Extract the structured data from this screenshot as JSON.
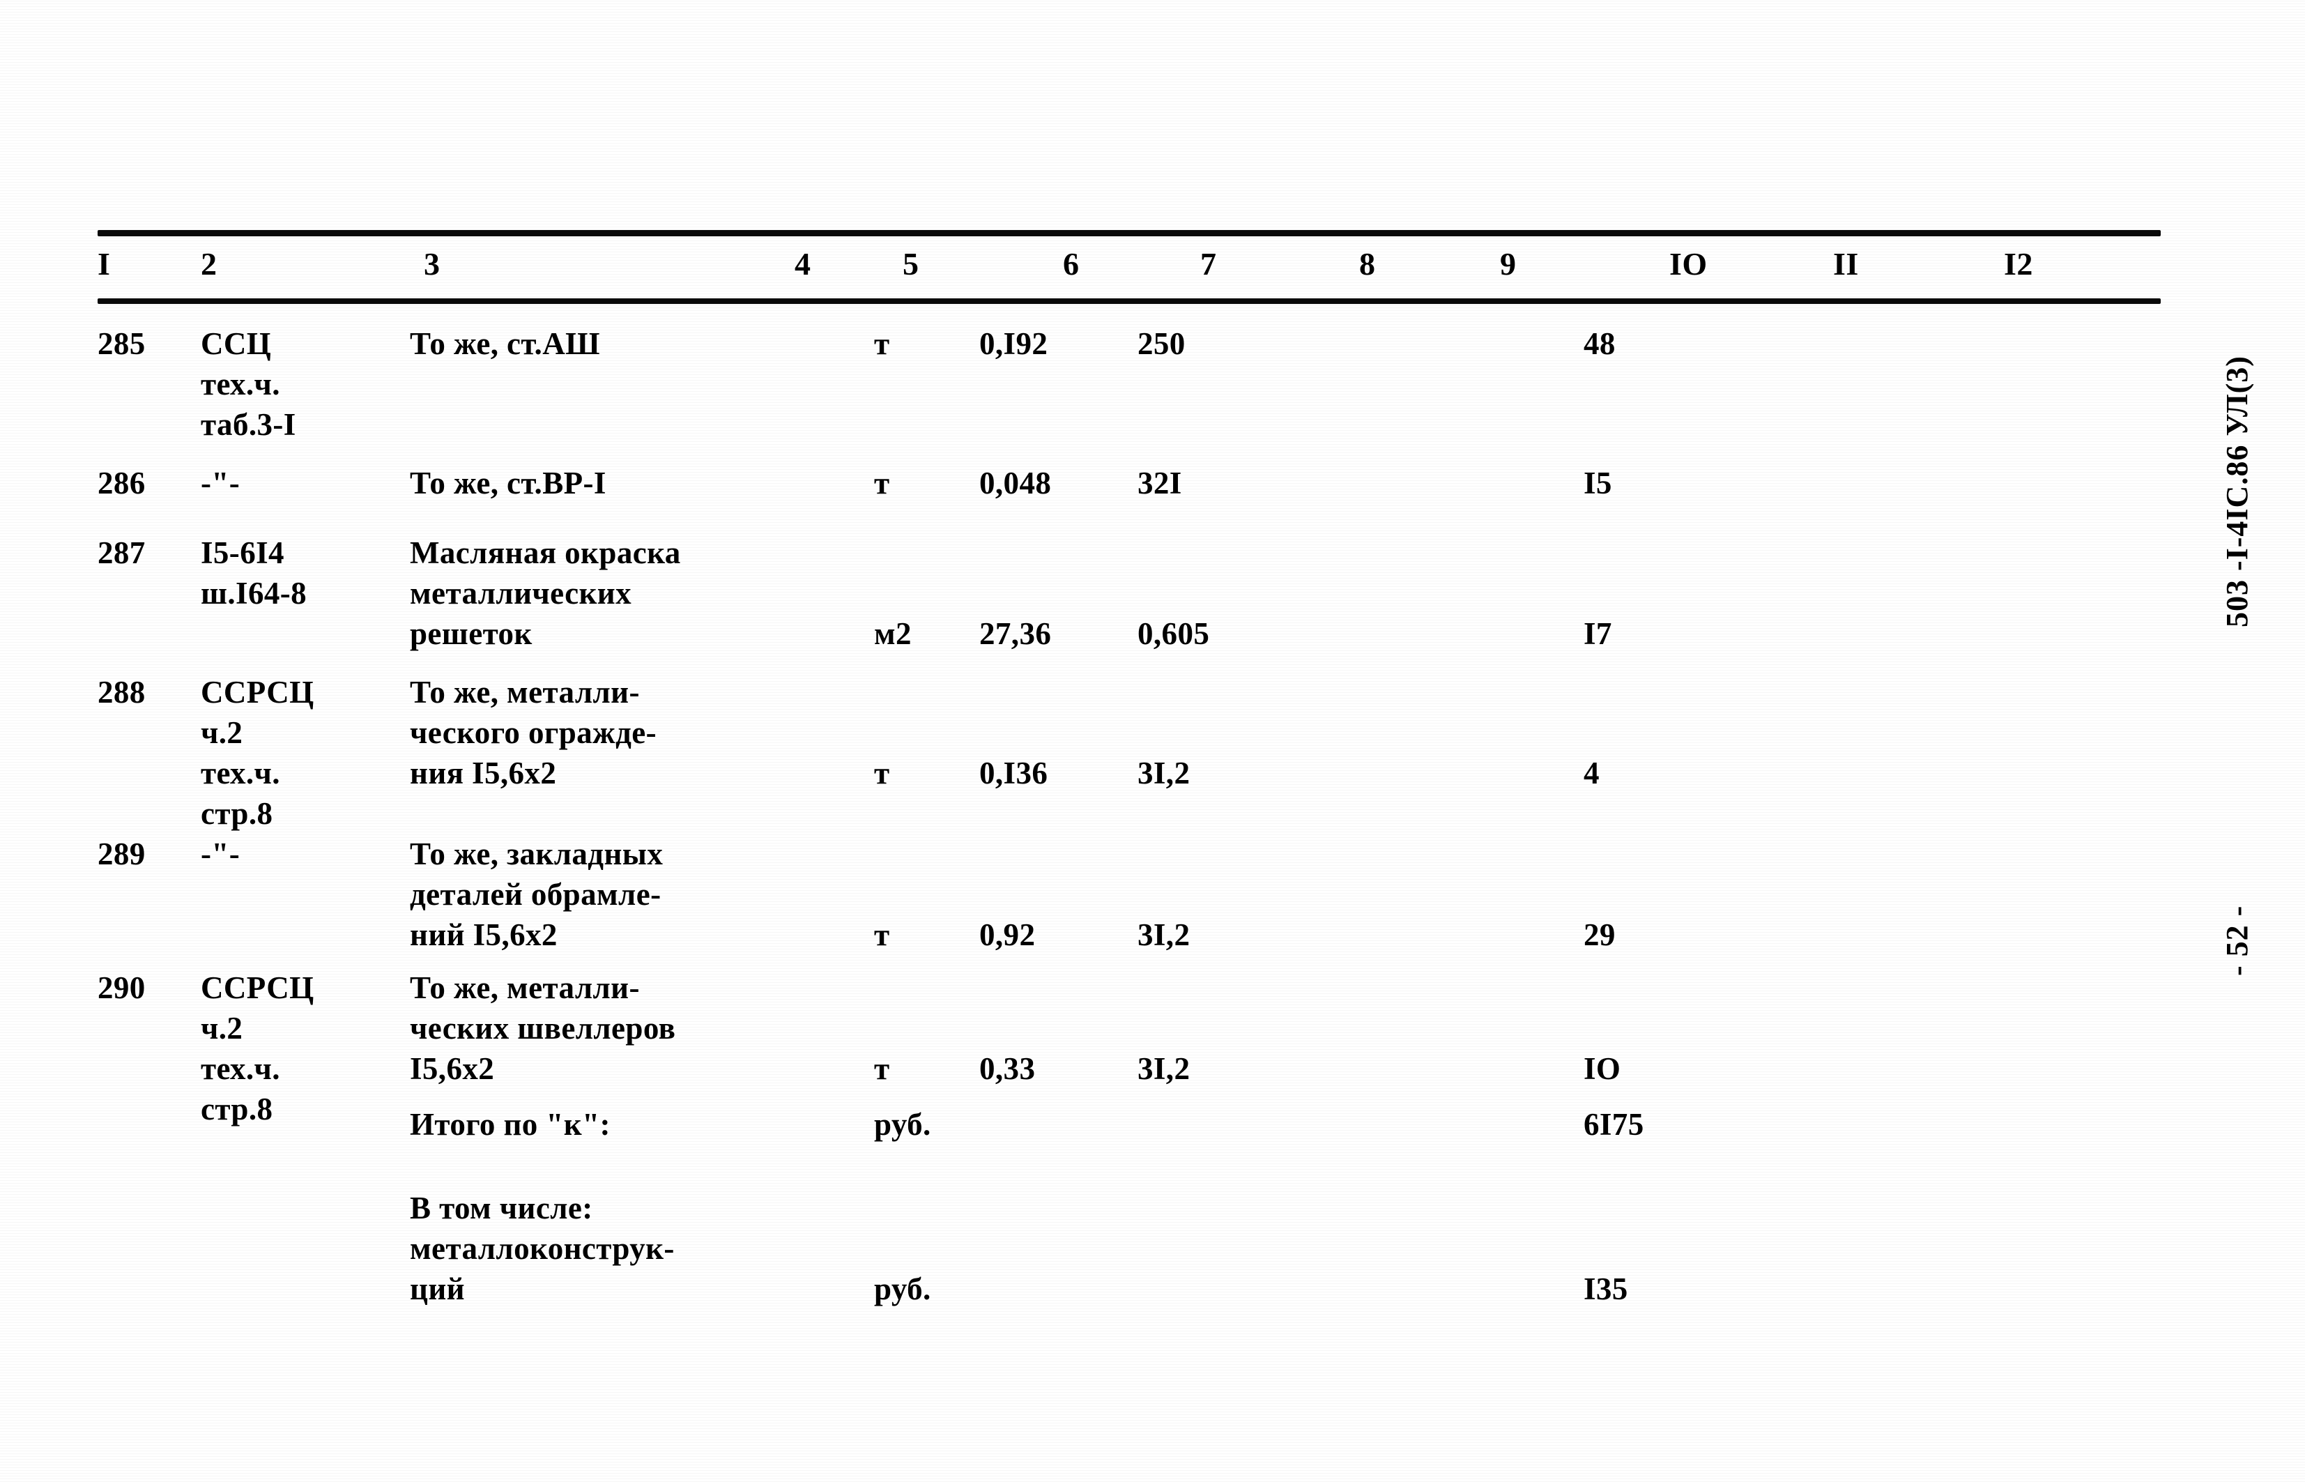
{
  "document": {
    "code_margin": "503 -I-4IC.86 УЛ(3)",
    "page_number": "- 52 -"
  },
  "table": {
    "column_headers": [
      "I",
      "2",
      "3",
      "4",
      "5",
      "6",
      "7",
      "8",
      "9",
      "IO",
      "II",
      "I2"
    ],
    "rows": [
      {
        "c1": "285",
        "c2": "ССЦ\nтех.ч.\nтаб.3-I",
        "c3": "То же, ст.АШ",
        "c4": "т",
        "c5": "0,I92",
        "c6": "250",
        "c7": "",
        "c8": "",
        "c9": "48",
        "c10": "",
        "c11": "",
        "c12": ""
      },
      {
        "c1": "286",
        "c2": "-\"-",
        "c3": "То же, ст.ВР-I",
        "c4": "т",
        "c5": "0,048",
        "c6": "32I",
        "c7": "",
        "c8": "",
        "c9": "I5",
        "c10": "",
        "c11": "",
        "c12": ""
      },
      {
        "c1": "287",
        "c2": "I5-6I4\nш.I64-8",
        "c3": "Масляная окраска\nметаллических\nрешеток",
        "c4": "м2",
        "c5": "27,36",
        "c6": "0,605",
        "c7": "",
        "c8": "",
        "c9": "I7",
        "c10": "",
        "c11": "",
        "c12": ""
      },
      {
        "c1": "288",
        "c2": "ССРСЦ\nч.2\nтех.ч.\nстр.8",
        "c3": "То же, металли-\nческого огражде-\nния I5,6х2",
        "c4": "т",
        "c5": "0,I36",
        "c6": "3I,2",
        "c7": "",
        "c8": "",
        "c9": "4",
        "c10": "",
        "c11": "",
        "c12": ""
      },
      {
        "c1": "289",
        "c2": "-\"-",
        "c3": "То же, закладных\nдеталей обрамле-\nний I5,6х2",
        "c4": "т",
        "c5": "0,92",
        "c6": "3I,2",
        "c7": "",
        "c8": "",
        "c9": "29",
        "c10": "",
        "c11": "",
        "c12": ""
      },
      {
        "c1": "290",
        "c2": "ССРСЦ\nч.2\nтех.ч.\nстр.8",
        "c3": "То же, металли-\nческих швеллеров\nI5,6х2",
        "c4": "т",
        "c5": "0,33",
        "c6": "3I,2",
        "c7": "",
        "c8": "",
        "c9": "IO",
        "c10": "",
        "c11": "",
        "c12": ""
      },
      {
        "c1": "",
        "c2": "",
        "c3": "Итого по \"к\":",
        "c4": "руб.",
        "c5": "",
        "c6": "",
        "c7": "",
        "c8": "",
        "c9": "6I75",
        "c10": "",
        "c11": "",
        "c12": ""
      },
      {
        "c1": "",
        "c2": "",
        "c3": "В том числе:\nметаллоконструк-\nций",
        "c4": "руб.",
        "c5": "",
        "c6": "",
        "c7": "",
        "c8": "",
        "c9": "I35",
        "c10": "",
        "c11": "",
        "c12": ""
      }
    ]
  }
}
